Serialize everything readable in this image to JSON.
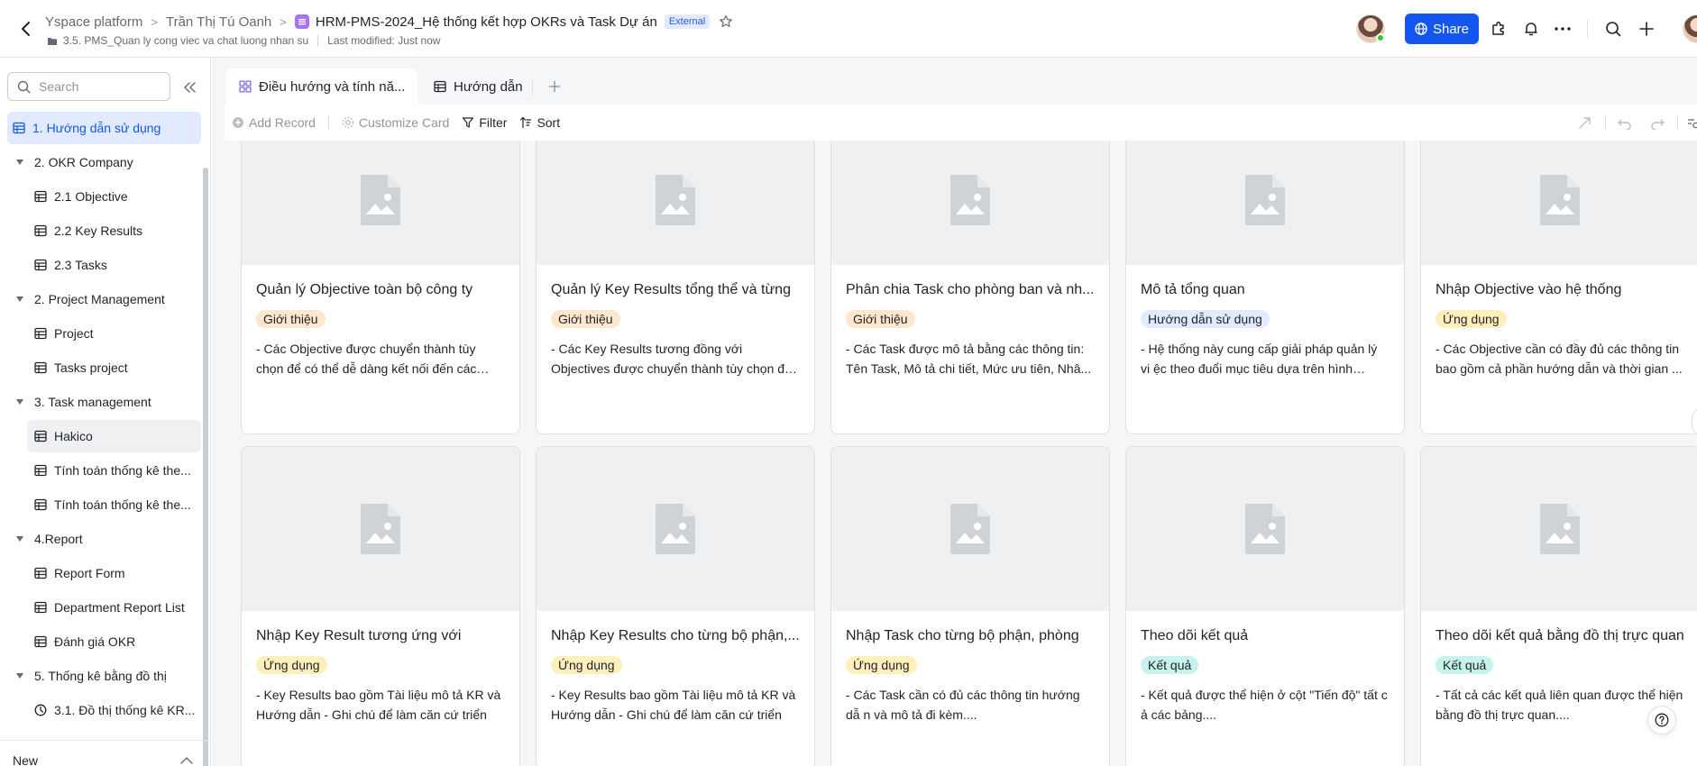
{
  "header": {
    "breadcrumbs": [
      "Yspace platform",
      "Trần Thị Tú Oanh"
    ],
    "doc_title": "HRM-PMS-2024_Hệ thống kết hợp OKRs và Task Dự án",
    "external_badge": "External",
    "folder": "3.5. PMS_Quan ly cong viec va chat luong nhan su",
    "last_modified": "Last modified: Just now",
    "share_label": "Share"
  },
  "sidebar": {
    "search_placeholder": "Search",
    "items": [
      {
        "label": "1. Hướng dẫn sử dụng",
        "type": "table",
        "level": 0
      },
      {
        "label": "2. OKR Company",
        "type": "folder",
        "level": 0
      },
      {
        "label": "2.1 Objective",
        "type": "table",
        "level": 1
      },
      {
        "label": "2.2 Key Results",
        "type": "table",
        "level": 1
      },
      {
        "label": "2.3 Tasks",
        "type": "table",
        "level": 1
      },
      {
        "label": "2. Project Management",
        "type": "folder",
        "level": 0
      },
      {
        "label": "Project",
        "type": "table",
        "level": 1
      },
      {
        "label": "Tasks project",
        "type": "table",
        "level": 1
      },
      {
        "label": "3. Task management",
        "type": "folder",
        "level": 0
      },
      {
        "label": "Hakico",
        "type": "table",
        "level": 1
      },
      {
        "label": "Tính toán thống kê the...",
        "type": "table",
        "level": 1
      },
      {
        "label": "Tính toán thống kê the...",
        "type": "table",
        "level": 1
      },
      {
        "label": "4.Report",
        "type": "folder",
        "level": 0
      },
      {
        "label": "Report Form",
        "type": "table",
        "level": 1
      },
      {
        "label": "Department Report List",
        "type": "table",
        "level": 1
      },
      {
        "label": "Đánh giá OKR",
        "type": "table",
        "level": 1
      },
      {
        "label": "5. Thống kê bằng đồ thị",
        "type": "folder",
        "level": 0
      },
      {
        "label": "3.1. Đồ thị thống kê KR...",
        "type": "dashboard",
        "level": 1
      }
    ],
    "new_label": "New"
  },
  "tabs": [
    {
      "label": "Điều hướng và tính nă...",
      "icon": "gallery-icon"
    },
    {
      "label": "Hướng dẫn",
      "icon": "table-icon"
    }
  ],
  "toolbar": {
    "add_record": "Add Record",
    "customize_card": "Customize Card",
    "filter": "Filter",
    "sort": "Sort"
  },
  "tag_colors": {
    "Giới thiệu": "#fee7cd",
    "Hướng dẫn sử dụng": "#e1eaff",
    "Ứng dụng": "#fdf0bd",
    "Kết quả": "#c8f2ed"
  },
  "cards": [
    {
      "title": "Quản lý Objective toàn bộ công ty",
      "tag": "Giới thiệu",
      "desc": "- Các Objective được chuyển thành tùy chọn để có thể dễ dàng kết nối đến các thành p..."
    },
    {
      "title": "Quản lý Key Results tổng thể và từng",
      "tag": "Giới thiệu",
      "desc": "- Các Key Results tương đồng với Objectives được chuyển thành tùy chọn để có thể dễ..."
    },
    {
      "title": "Phân chia Task cho phòng ban và nh...",
      "tag": "Giới thiệu",
      "desc": "- Các Task được mô tả bằng các thông tin: Tên Task, Mô tả chi tiết, Mức ưu tiên, Nhâ..."
    },
    {
      "title": "Mô tả tổng quan",
      "tag": "Hướng dẫn sử dụng",
      "desc": "- Hệ thống này cung cấp giải pháp quản lý vi ệc theo đuổi mục tiêu dựa trên hình thức..."
    },
    {
      "title": "Nhập Objective vào hệ thống",
      "tag": "Ứng dụng",
      "desc": "- Các Objective cần có đầy đủ các thông tin bao gồm cả phần hướng dẫn và thời gian ..."
    },
    {
      "title": "Nhập Key Result tương ứng với",
      "tag": "Ứng dụng",
      "desc": "- Key Results bao gồm Tài liệu mô tả KR và Hướng dẫn - Ghi chú để làm căn cứ triển"
    },
    {
      "title": "Nhập Key Results cho từng bộ phận,...",
      "tag": "Ứng dụng",
      "desc": "- Key Results bao gồm Tài liệu mô tả KR và Hướng dẫn - Ghi chú để làm căn cứ triển"
    },
    {
      "title": "Nhập Task cho từng bộ phận, phòng",
      "tag": "Ứng dụng",
      "desc": "- Các Task cần có đủ các thông tin hướng dẫ n và mô tả đi kèm...."
    },
    {
      "title": "Theo dõi kết quả",
      "tag": "Kết quả",
      "desc": "- Kết quả được thể hiện ở cột \"Tiến độ\" tất c ả các bảng...."
    },
    {
      "title": "Theo dõi kết quả bằng đồ thị trực quan",
      "tag": "Kết quả",
      "desc": "- Tất cả các kết quả liên quan được thể hiện bằng đồ thị trực quan...."
    }
  ]
}
